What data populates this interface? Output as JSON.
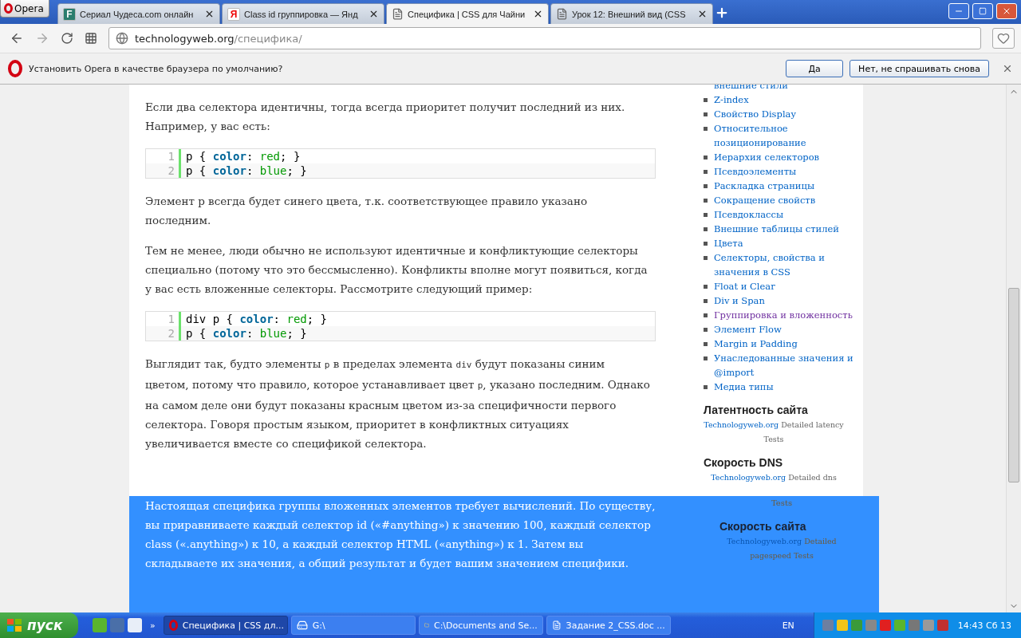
{
  "browser": {
    "opera_button": "Opera",
    "tabs": [
      {
        "title": "Сериал Чудеса.com онлайн",
        "icon_text": "F",
        "selected": false
      },
      {
        "title": "Class id группировка — Янд",
        "icon_text": "Я",
        "selected": false
      },
      {
        "title": "Специфика | CSS для Чайни",
        "selected": true
      },
      {
        "title": "Урок 12: Внешний вид (CSS",
        "selected": false
      }
    ]
  },
  "address": {
    "host": "technologyweb.org",
    "path": "/специфика/"
  },
  "infobar": {
    "message": "Установить Opera в качестве браузера по умолчанию?",
    "buttons": [
      "Да",
      "Нет, не спрашивать снова"
    ]
  },
  "article": [
    {
      "kind": "text",
      "parts": [
        {
          "text": "Если два селектора идентичны, тогда всегда приоритет получит последний из них. Например, у вас есть:",
          "code": false
        }
      ]
    },
    {
      "kind": "code",
      "lines": [
        {
          "num": "1",
          "tokens": [
            {
              "t": "p { ",
              "kind": "plain"
            },
            {
              "t": "color",
              "kind": "prop"
            },
            {
              "t": ": ",
              "kind": "plain"
            },
            {
              "t": "red",
              "kind": "value"
            },
            {
              "t": "; }",
              "kind": "plain"
            }
          ]
        },
        {
          "num": "2",
          "tokens": [
            {
              "t": "p { ",
              "kind": "plain"
            },
            {
              "t": "color",
              "kind": "prop"
            },
            {
              "t": ": ",
              "kind": "plain"
            },
            {
              "t": "blue",
              "kind": "value"
            },
            {
              "t": "; }",
              "kind": "plain"
            }
          ]
        }
      ]
    },
    {
      "kind": "text",
      "parts": [
        {
          "text": "Элемент p всегда будет синего цвета, т.к. соответствующее правило указано последним.",
          "code": false
        }
      ]
    },
    {
      "kind": "text",
      "parts": [
        {
          "text": "Тем не менее, люди обычно не используют идентичные и конфликтующие селекторы специально (потому что это бессмысленно). Конфликты вполне могут появиться, когда у вас есть вложенные селекторы. Рассмотрите следующий пример:",
          "code": false
        }
      ]
    },
    {
      "kind": "code",
      "lines": [
        {
          "num": "1",
          "tokens": [
            {
              "t": "div p { ",
              "kind": "plain"
            },
            {
              "t": "color",
              "kind": "prop"
            },
            {
              "t": ": ",
              "kind": "plain"
            },
            {
              "t": "red",
              "kind": "value"
            },
            {
              "t": "; }",
              "kind": "plain"
            }
          ]
        },
        {
          "num": "2",
          "tokens": [
            {
              "t": "p { ",
              "kind": "plain"
            },
            {
              "t": "color",
              "kind": "prop"
            },
            {
              "t": ": ",
              "kind": "plain"
            },
            {
              "t": "blue",
              "kind": "value"
            },
            {
              "t": "; }",
              "kind": "plain"
            }
          ]
        }
      ]
    },
    {
      "kind": "text",
      "parts": [
        {
          "text": "Выглядит так, будто элементы ",
          "code": false
        },
        {
          "text": "p",
          "code": true
        },
        {
          "text": " в пределах элемента ",
          "code": false
        },
        {
          "text": "div",
          "code": true
        },
        {
          "text": " будут показаны синим цветом, потому что правило, которое устанавливает цвет ",
          "code": false
        },
        {
          "text": "p",
          "code": true
        },
        {
          "text": ", указано последним. Однако на самом деле они будут показаны красным цветом из-за специфичности первого селектора. Говоря простым языком, приоритет в конфликтных ситуациях увеличивается вместе со спецификой селектора.",
          "code": false
        }
      ]
    }
  ],
  "sidebar": {
    "items": [
      {
        "label": "внешние стили",
        "kind": "continuation",
        "visited": false
      },
      {
        "label": "Z-index",
        "kind": "item",
        "visited": false
      },
      {
        "label": "Свойство Display",
        "kind": "item",
        "visited": false
      },
      {
        "label": "Относительное позиционирование",
        "kind": "item",
        "visited": false
      },
      {
        "label": "Иерархия селекторов",
        "kind": "item",
        "visited": false
      },
      {
        "label": "Псевдоэлементы",
        "kind": "item",
        "visited": false
      },
      {
        "label": "Раскладка страницы",
        "kind": "item",
        "visited": false
      },
      {
        "label": "Сокращение свойств",
        "kind": "item",
        "visited": false
      },
      {
        "label": "Псевдоклассы",
        "kind": "item",
        "visited": false
      },
      {
        "label": "Внешние таблицы стилей",
        "kind": "item",
        "visited": false
      },
      {
        "label": "Цвета",
        "kind": "item",
        "visited": false
      },
      {
        "label": "Селекторы, свойства и значения в CSS",
        "kind": "item",
        "visited": false
      },
      {
        "label": "Float и Clear",
        "kind": "item",
        "visited": false
      },
      {
        "label": "Div и Span",
        "kind": "item",
        "visited": false
      },
      {
        "label": "Группировка и вложенность",
        "kind": "item",
        "visited": true
      },
      {
        "label": "Элемент Flow",
        "kind": "item",
        "visited": false
      },
      {
        "label": "Margin и Padding",
        "kind": "item",
        "visited": false
      },
      {
        "label": "Унаследованные значения и @import",
        "kind": "item",
        "visited": false
      },
      {
        "label": "Медиа типы",
        "kind": "item",
        "visited": false
      }
    ],
    "latency": {
      "title": "Латентность сайта",
      "link": "Technologyweb.org",
      "text": "Detailed latency Tests"
    },
    "dns": {
      "title": "Скорость DNS",
      "link": "Technologyweb.org",
      "text": "Detailed dns"
    }
  },
  "selection": {
    "paragraph": "Настоящая специфика группы вложенных элементов требует вычислений. По существу, вы приравниваете каждый селектор id («#anything») к значению 100, каждый селектор class («.anything») к 10, а каждый селектор HTML («anything») к 1. Затем вы складываете их значения, а общий результат и будет вашим значением специфики.",
    "dns_tail": "Tests",
    "speed": {
      "title": "Скорость сайта",
      "link": "Technologyweb.org",
      "text": "Detailed pagespeed Tests"
    }
  },
  "taskbar": {
    "start": "пуск",
    "more": "»",
    "tasks": [
      {
        "label": "Специфика | CSS дл...",
        "selected": true
      },
      {
        "label": "G:\\",
        "selected": false
      },
      {
        "label": "C:\\Documents and Se...",
        "selected": false
      },
      {
        "label": "Задание 2_CSS.doc ...",
        "selected": false
      }
    ],
    "language": "EN",
    "clock": "14:43 Сб 13"
  }
}
